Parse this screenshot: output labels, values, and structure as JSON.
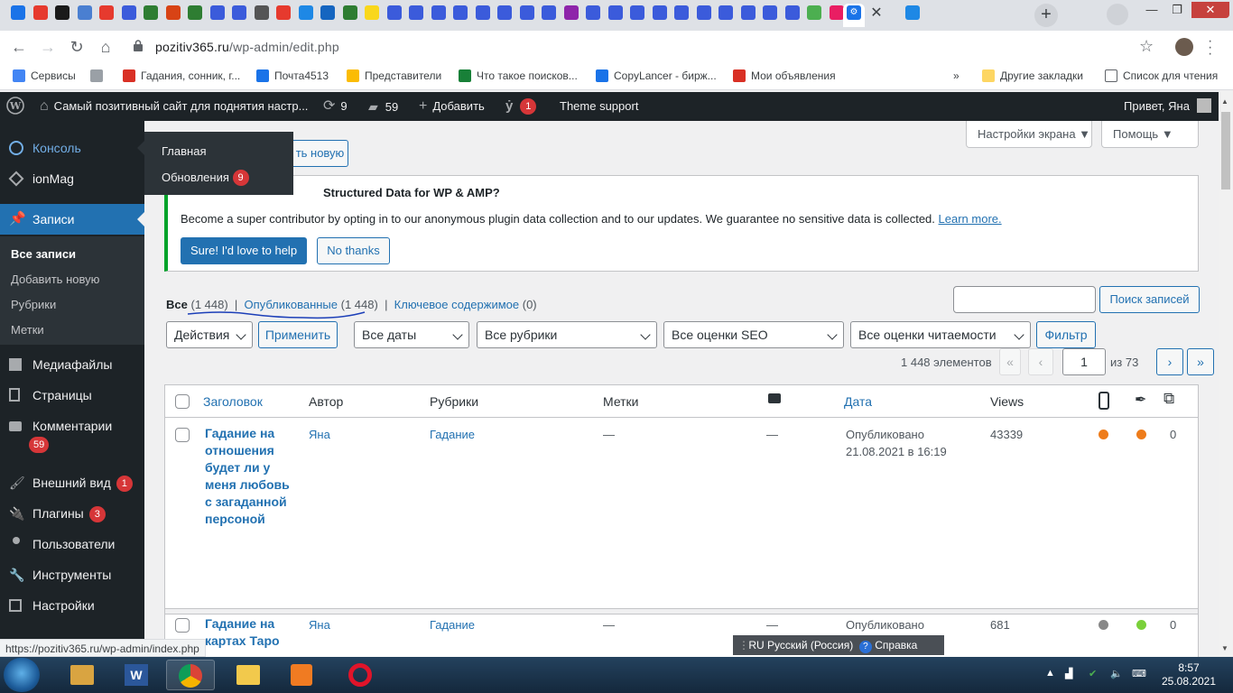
{
  "browser": {
    "url_host": "pozitiv365.ru",
    "url_path": "/wp-admin/edit.php",
    "status_url": "https://pozitiv365.ru/wp-admin/index.php",
    "tab_favicons": [
      "#1a73e8",
      "#e63a2e",
      "#1a1a1a",
      "#4a7fd1",
      "#e63a2e",
      "#3b5bdb",
      "#2e7d32",
      "#d84315",
      "#2e7d32",
      "#3b5bdb",
      "#3b5bdb",
      "#555555",
      "#e63a2e",
      "#1e88e5",
      "#1565c0",
      "#2e7d32",
      "#f9d71c",
      "#3b5bdb",
      "#3b5bdb",
      "#3b5bdb",
      "#3b5bdb",
      "#3b5bdb",
      "#3b5bdb",
      "#3b5bdb",
      "#3b5bdb",
      "#8e24aa",
      "#3b5bdb",
      "#3b5bdb",
      "#3b5bdb",
      "#3b5bdb",
      "#3b5bdb",
      "#3b5bdb",
      "#3b5bdb",
      "#3b5bdb",
      "#3b5bdb",
      "#3b5bdb",
      "#4caf50",
      "#e91e63",
      "#1e88e5"
    ],
    "bookmarks": [
      {
        "label": "Сервисы",
        "color": "#4285f4"
      },
      {
        "label": "",
        "color": "#9aa0a6"
      },
      {
        "label": "Гадания, сонник, г...",
        "color": "#d93025"
      },
      {
        "label": "Почта4513",
        "color": "#1a73e8"
      },
      {
        "label": "Представители",
        "color": "#fbbc04"
      },
      {
        "label": "Что такое поисков...",
        "color": "#188038"
      },
      {
        "label": "CopyLancer - бирж...",
        "color": "#1a73e8"
      },
      {
        "label": "Мои объявления",
        "color": "#d93025"
      }
    ],
    "other_bookmarks": "Другие закладки",
    "reading_list": "Список для чтения"
  },
  "adminbar": {
    "site_name": "Самый позитивный сайт для поднятия настр...",
    "updates_count": "9",
    "comments_count": "59",
    "add_new": "Добавить",
    "yoast_count": "1",
    "theme_support": "Theme support",
    "greeting": "Привет, Яна"
  },
  "sidebar": {
    "items": [
      {
        "label": "Консоль",
        "badge": ""
      },
      {
        "label": "ionMag",
        "badge": ""
      },
      {
        "label": "Записи",
        "badge": ""
      },
      {
        "label": "Медиафайлы",
        "badge": ""
      },
      {
        "label": "Страницы",
        "badge": ""
      },
      {
        "label": "Комментарии",
        "badge": "59"
      },
      {
        "label": "Внешний вид",
        "badge": "1"
      },
      {
        "label": "Плагины",
        "badge": "3"
      },
      {
        "label": "Пользователи",
        "badge": ""
      },
      {
        "label": "Инструменты",
        "badge": ""
      },
      {
        "label": "Настройки",
        "badge": ""
      }
    ],
    "submenu": [
      "Все записи",
      "Добавить новую",
      "Рубрики",
      "Метки"
    ],
    "flyout": {
      "home": "Главная",
      "updates": "Обновления",
      "updates_badge": "9"
    }
  },
  "main": {
    "add_new_partial": "ть новую",
    "screen_options": "Настройки экрана",
    "help": "Помощь",
    "notice": {
      "title_partial": "Structured Data for WP & AMP?",
      "text": "Become a super contributor by opting in to our anonymous plugin data collection and to our updates. We guarantee no sensitive data is collected.",
      "link": "Learn more.",
      "accept": "Sure! I'd love to help",
      "decline": "No thanks"
    },
    "views": {
      "all": "Все",
      "all_count": "(1 448)",
      "published": "Опубликованные",
      "published_count": "(1 448)",
      "cornerstone": "Ключевое содержимое",
      "cornerstone_count": "(0)"
    },
    "search_button": "Поиск записей",
    "filters": {
      "bulk_actions": "Действия",
      "apply": "Применить",
      "dates": "Все даты",
      "categories": "Все рубрики",
      "seo": "Все оценки SEO",
      "readability": "Все оценки читаемости",
      "filter": "Фильтр"
    },
    "pagination": {
      "items": "1 448 элементов",
      "first": "«",
      "prev": "‹",
      "current": "1",
      "of": "из 73",
      "next": "›",
      "last": "»"
    },
    "table": {
      "headers": {
        "title": "Заголовок",
        "author": "Автор",
        "categories": "Рубрики",
        "tags": "Метки",
        "date": "Дата",
        "views": "Views"
      },
      "rows": [
        {
          "title": "Гадание на отношения будет ли у меня любовь с загаданной персоной",
          "author": "Яна",
          "category": "Гадание",
          "tags": "—",
          "comments": "—",
          "status": "Опубликовано",
          "date": "21.08.2021 в 16:19",
          "views": "43339",
          "seo_color": "#ee7c1b",
          "read_color": "#ee7c1b",
          "links": "0"
        },
        {
          "title": "Гадание на картах Таро",
          "author": "Яна",
          "category": "Гадание",
          "tags": "—",
          "comments": "—",
          "status": "Опубликовано",
          "date": "",
          "views": "681",
          "seo_color": "#888888",
          "read_color": "#7ad03a",
          "links": "0"
        }
      ]
    }
  },
  "langbar": {
    "lang": "RU Русский (Россия)",
    "help": "Справка"
  },
  "taskbar": {
    "time": "8:57",
    "date": "25.08.2021"
  }
}
